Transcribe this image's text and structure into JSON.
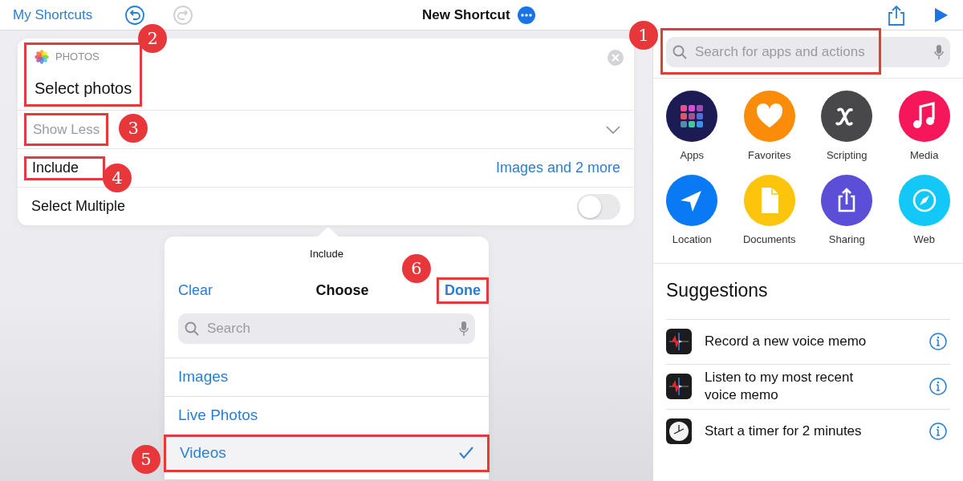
{
  "toolbar": {
    "back_label": "My Shortcuts",
    "title": "New Shortcut"
  },
  "action_card": {
    "app_label": "PHOTOS",
    "title": "Select photos",
    "callout": "2",
    "show_less": {
      "label": "Show Less",
      "callout": "3"
    },
    "include": {
      "label": "Include",
      "value": "Images and 2 more",
      "callout": "4"
    },
    "select_multiple": {
      "label": "Select Multiple",
      "on": false
    }
  },
  "popover": {
    "header": "Include",
    "clear": "Clear",
    "title": "Choose",
    "done": "Done",
    "done_callout": "6",
    "search_placeholder": "Search",
    "options": [
      {
        "label": "Images",
        "selected": false
      },
      {
        "label": "Live Photos",
        "selected": false
      },
      {
        "label": "Videos",
        "selected": true,
        "callout": "5"
      }
    ]
  },
  "library": {
    "search_placeholder": "Search for apps and actions",
    "search_callout": "1",
    "categories": [
      {
        "label": "Apps",
        "kind": "apps",
        "color": "#1d1b54"
      },
      {
        "label": "Favorites",
        "kind": "favorites",
        "color": "#fb8c0a"
      },
      {
        "label": "Scripting",
        "kind": "scripting",
        "color": "#48484a"
      },
      {
        "label": "Media",
        "kind": "media",
        "color": "#f5175a"
      },
      {
        "label": "Location",
        "kind": "location",
        "color": "#0a7af4"
      },
      {
        "label": "Documents",
        "kind": "documents",
        "color": "#fcc40a"
      },
      {
        "label": "Sharing",
        "kind": "sharing",
        "color": "#5a4fd6"
      },
      {
        "label": "Web",
        "kind": "web",
        "color": "#12c8f6"
      }
    ],
    "suggestions_title": "Suggestions",
    "suggestions": [
      {
        "label": "Record a new voice memo",
        "kind": "voice-memo"
      },
      {
        "label": "Listen to my most recent voice memo",
        "kind": "voice-memo"
      },
      {
        "label": "Start a timer for 2 minutes",
        "kind": "clock"
      }
    ]
  }
}
